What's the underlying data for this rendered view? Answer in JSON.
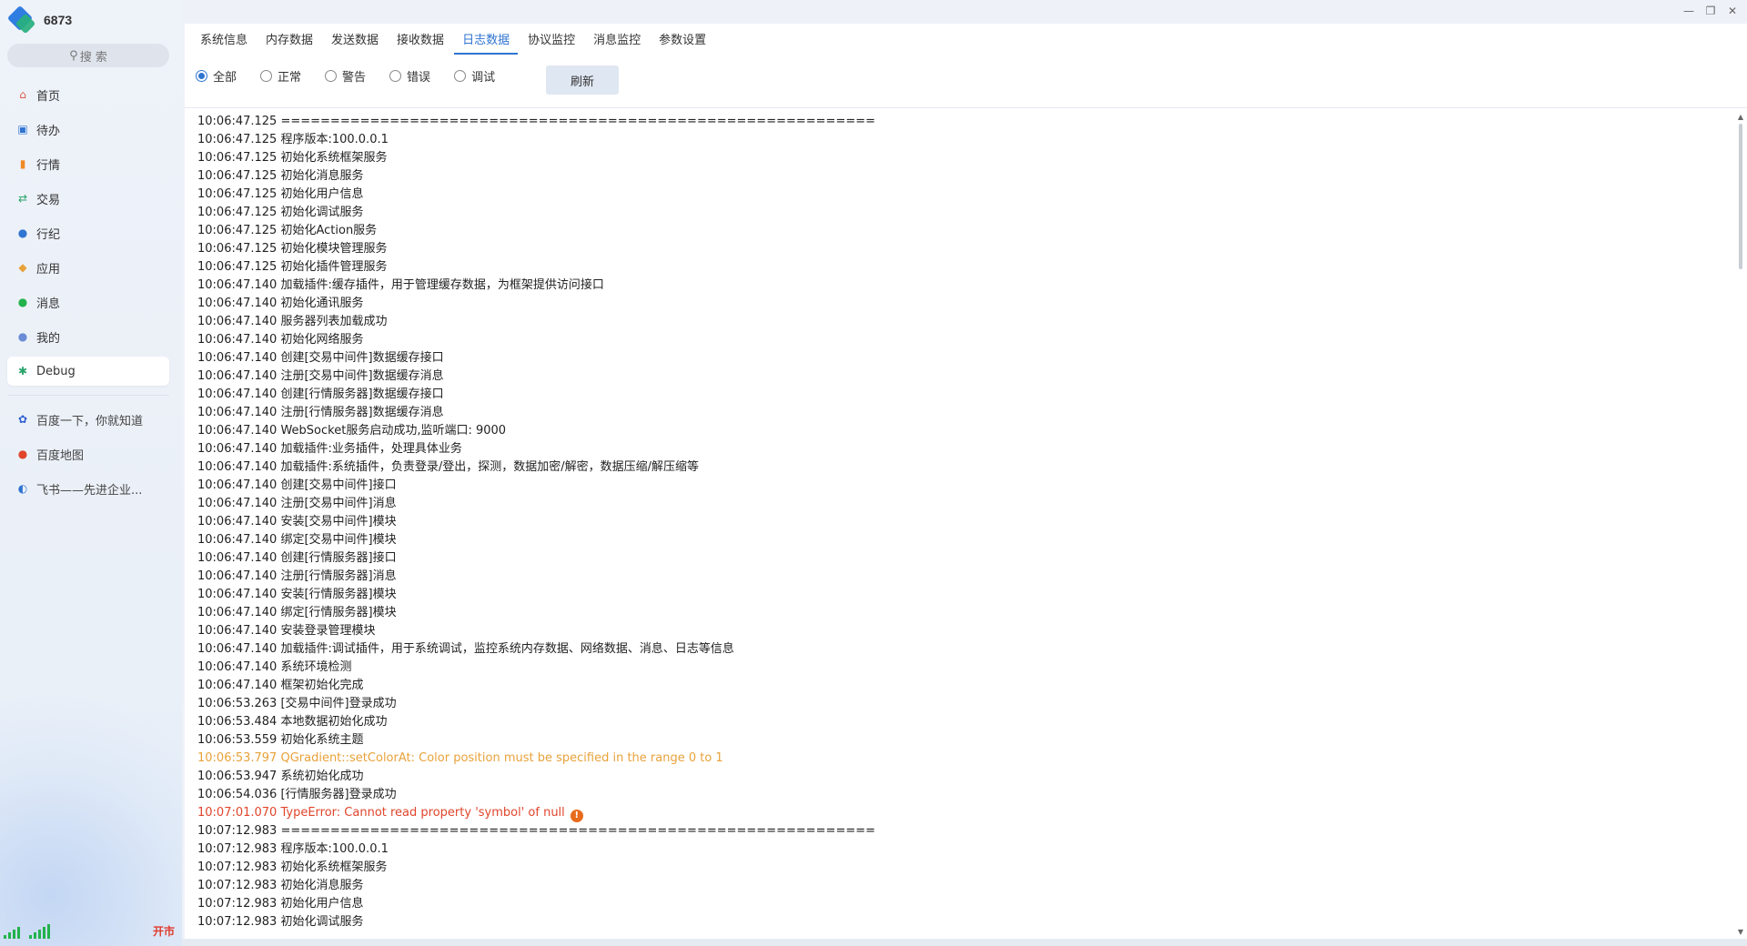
{
  "app": {
    "title": "6873"
  },
  "window_controls": {
    "minimize": "—",
    "restore": "❐",
    "close": "✕"
  },
  "search": {
    "label": "搜 索"
  },
  "sidebar": {
    "items": [
      {
        "label": "首页",
        "icon": "home-icon",
        "glyph": "⌂",
        "color": "#e05a4a"
      },
      {
        "label": "待办",
        "icon": "todo-icon",
        "glyph": "▣",
        "color": "#2f74d0"
      },
      {
        "label": "行情",
        "icon": "chart-icon",
        "glyph": "▮",
        "color": "#f08a24"
      },
      {
        "label": "交易",
        "icon": "trade-icon",
        "glyph": "⇄",
        "color": "#2aa36a"
      },
      {
        "label": "行纪",
        "icon": "user-icon",
        "glyph": "●",
        "color": "#2f74d0"
      },
      {
        "label": "应用",
        "icon": "apps-icon",
        "glyph": "◆",
        "color": "#e8a23a"
      },
      {
        "label": "消息",
        "icon": "message-icon",
        "glyph": "●",
        "color": "#22b24c"
      },
      {
        "label": "我的",
        "icon": "profile-icon",
        "glyph": "●",
        "color": "#6a8bd6"
      },
      {
        "label": "Debug",
        "icon": "bug-icon",
        "glyph": "✱",
        "color": "#2aa36a",
        "active": true
      }
    ],
    "bookmarks": [
      {
        "label": "百度一下，你就知道",
        "icon": "baidu-icon",
        "glyph": "✿",
        "color": "#2f5fd0"
      },
      {
        "label": "百度地图",
        "icon": "map-pin-icon",
        "glyph": "●",
        "color": "#e0452c"
      },
      {
        "label": "飞书——先进企业...",
        "icon": "feishu-icon",
        "glyph": "◐",
        "color": "#2f74d0"
      }
    ]
  },
  "status": {
    "market": "开市",
    "signal_color": "#22b24c"
  },
  "tabs": [
    {
      "label": "系统信息"
    },
    {
      "label": "内存数据"
    },
    {
      "label": "发送数据"
    },
    {
      "label": "接收数据"
    },
    {
      "label": "日志数据",
      "active": true
    },
    {
      "label": "协议监控"
    },
    {
      "label": "消息监控"
    },
    {
      "label": "参数设置"
    }
  ],
  "filters": [
    {
      "label": "全部",
      "checked": true
    },
    {
      "label": "正常"
    },
    {
      "label": "警告"
    },
    {
      "label": "错误"
    },
    {
      "label": "调试"
    }
  ],
  "refresh_label": "刷新",
  "logs": [
    {
      "text": "10:06:47.125 ============================================================"
    },
    {
      "text": "10:06:47.125 程序版本:100.0.0.1"
    },
    {
      "text": "10:06:47.125 初始化系统框架服务"
    },
    {
      "text": "10:06:47.125 初始化消息服务"
    },
    {
      "text": "10:06:47.125 初始化用户信息"
    },
    {
      "text": "10:06:47.125 初始化调试服务"
    },
    {
      "text": "10:06:47.125 初始化Action服务"
    },
    {
      "text": "10:06:47.125 初始化模块管理服务"
    },
    {
      "text": "10:06:47.125 初始化插件管理服务"
    },
    {
      "text": "10:06:47.140 加载插件:缓存插件，用于管理缓存数据，为框架提供访问接口"
    },
    {
      "text": "10:06:47.140 初始化通讯服务"
    },
    {
      "text": "10:06:47.140 服务器列表加载成功"
    },
    {
      "text": "10:06:47.140 初始化网络服务"
    },
    {
      "text": "10:06:47.140 创建[交易中间件]数据缓存接口"
    },
    {
      "text": "10:06:47.140 注册[交易中间件]数据缓存消息"
    },
    {
      "text": "10:06:47.140 创建[行情服务器]数据缓存接口"
    },
    {
      "text": "10:06:47.140 注册[行情服务器]数据缓存消息"
    },
    {
      "text": "10:06:47.140 WebSocket服务启动成功,监听端口: 9000"
    },
    {
      "text": "10:06:47.140 加载插件:业务插件，处理具体业务"
    },
    {
      "text": "10:06:47.140 加载插件:系统插件，负责登录/登出，探测，数据加密/解密，数据压缩/解压缩等"
    },
    {
      "text": "10:06:47.140 创建[交易中间件]接口"
    },
    {
      "text": "10:06:47.140 注册[交易中间件]消息"
    },
    {
      "text": "10:06:47.140 安装[交易中间件]模块"
    },
    {
      "text": "10:06:47.140 绑定[交易中间件]模块"
    },
    {
      "text": "10:06:47.140 创建[行情服务器]接口"
    },
    {
      "text": "10:06:47.140 注册[行情服务器]消息"
    },
    {
      "text": "10:06:47.140 安装[行情服务器]模块"
    },
    {
      "text": "10:06:47.140 绑定[行情服务器]模块"
    },
    {
      "text": "10:06:47.140 安装登录管理模块"
    },
    {
      "text": "10:06:47.140 加载插件:调试插件，用于系统调试，监控系统内存数据、网络数据、消息、日志等信息"
    },
    {
      "text": "10:06:47.140 系统环境检测"
    },
    {
      "text": "10:06:47.140 框架初始化完成"
    },
    {
      "text": "10:06:53.263 [交易中间件]登录成功"
    },
    {
      "text": "10:06:53.484 本地数据初始化成功"
    },
    {
      "text": "10:06:53.559 初始化系统主题"
    },
    {
      "text": "10:06:53.797 QGradient::setColorAt: Color position must be specified in the range 0 to 1",
      "level": "warning"
    },
    {
      "text": "10:06:53.947 系统初始化成功"
    },
    {
      "text": "10:06:54.036 [行情服务器]登录成功"
    },
    {
      "text": "10:07:01.070 TypeError: Cannot read property 'symbol' of null",
      "level": "error",
      "badge": "!"
    },
    {
      "text": "10:07:12.983 ============================================================"
    },
    {
      "text": "10:07:12.983 程序版本:100.0.0.1"
    },
    {
      "text": "10:07:12.983 初始化系统框架服务"
    },
    {
      "text": "10:07:12.983 初始化消息服务"
    },
    {
      "text": "10:07:12.983 初始化用户信息"
    },
    {
      "text": "10:07:12.983 初始化调试服务"
    }
  ]
}
